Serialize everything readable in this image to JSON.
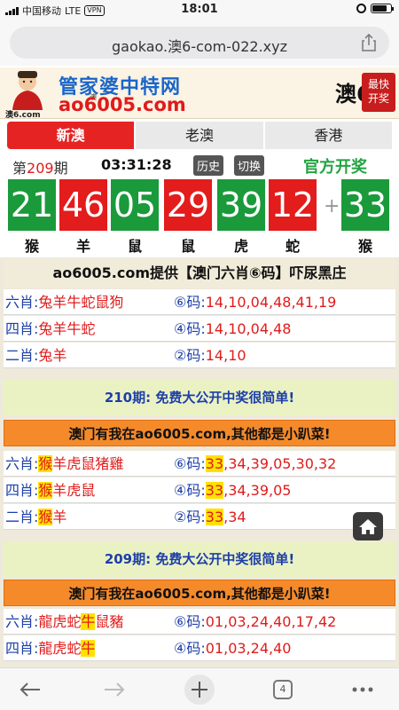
{
  "status": {
    "carrier": "中国移动",
    "network": "LTE",
    "vpn": "VPN",
    "time": "18:01"
  },
  "browser": {
    "url": "gaokao.澳6-com-022.xyz",
    "toolbar": {
      "tabs_count": "4"
    }
  },
  "banner": {
    "mascot_label": "澳6.com",
    "title": "管家婆中特网",
    "small_label": "澳",
    "domain": "ao6005.com",
    "macau": "澳6",
    "seal_line1": "最快",
    "seal_line2": "开奖"
  },
  "tabs": [
    {
      "label": "新澳"
    },
    {
      "label": "老澳"
    },
    {
      "label": "香港"
    }
  ],
  "draw": {
    "period_prefix": "第",
    "period_num": "209",
    "period_suffix": "期",
    "clock": "03:31:28",
    "history_btn": "历史",
    "switch_btn": "切换",
    "official": "官方开奖",
    "balls": [
      {
        "num": "21",
        "zodiac": "猴",
        "color": "green"
      },
      {
        "num": "46",
        "zodiac": "羊",
        "color": "red"
      },
      {
        "num": "05",
        "zodiac": "鼠",
        "color": "green"
      },
      {
        "num": "29",
        "zodiac": "鼠",
        "color": "red"
      },
      {
        "num": "39",
        "zodiac": "虎",
        "color": "green"
      },
      {
        "num": "12",
        "zodiac": "蛇",
        "color": "red"
      }
    ],
    "special": {
      "num": "33",
      "zodiac": "猴",
      "color": "green"
    },
    "plus": "+"
  },
  "content": {
    "header": "ao6005.com提供【澳门六肖⑥码】吓尿黑庄",
    "block1": [
      {
        "zlabel": "六肖:",
        "zval": "兔羊牛蛇鼠狗",
        "clabel": "⑥码:",
        "cval": "14,10,04,48,41,19"
      },
      {
        "zlabel": "四肖:",
        "zval": "兔羊牛蛇",
        "clabel": "④码:",
        "cval": "14,10,04,48"
      },
      {
        "zlabel": "二肖:",
        "zval": "兔羊",
        "clabel": "②码:",
        "cval": "14,10"
      }
    ],
    "notice1": "210期: 免费大公开中奖很简单!",
    "ad1": "澳门有我在ao6005.com,其他都是小趴菜!",
    "block2": [
      {
        "zlabel": "六肖:",
        "zhl": "猴",
        "zval": "羊虎鼠猪雞",
        "clabel": "⑥码:",
        "chl": "33",
        "cval": ",34,39,05,30,32"
      },
      {
        "zlabel": "四肖:",
        "zhl": "猴",
        "zval": "羊虎鼠",
        "clabel": "④码:",
        "chl": "33",
        "cval": ",34,39,05"
      },
      {
        "zlabel": "二肖:",
        "zhl": "猴",
        "zval": "羊",
        "clabel": "②码:",
        "chl": "33",
        "cval": ",34"
      }
    ],
    "notice2": "209期: 免费大公开中奖很简单!",
    "ad2": "澳门有我在ao6005.com,其他都是小趴菜!",
    "block3": [
      {
        "zlabel": "六肖:",
        "zpre": "龍虎蛇",
        "zhl": "牛",
        "zval": "鼠豬",
        "clabel": "⑥码:",
        "cval": "01,03,24,40,17,42"
      },
      {
        "zlabel": "四肖:",
        "zpre": "龍虎蛇",
        "zhl": "牛",
        "zval": "",
        "clabel": "④码:",
        "cval": "01,03,24,40"
      }
    ]
  },
  "icons": {
    "back": "back-arrow-icon",
    "forward": "forward-arrow-icon",
    "new_tab": "plus-icon",
    "tabs": "tabs-icon",
    "menu": "more-icon",
    "share": "share-icon",
    "home": "home-icon"
  },
  "colors": {
    "red_ball": "#e31c1c",
    "green_ball": "#1a9a3a",
    "active_tab": "#e62323",
    "notice_bg": "#eaf2c4",
    "ad_bg": "#f58a2a",
    "highlight": "#ffe100"
  }
}
